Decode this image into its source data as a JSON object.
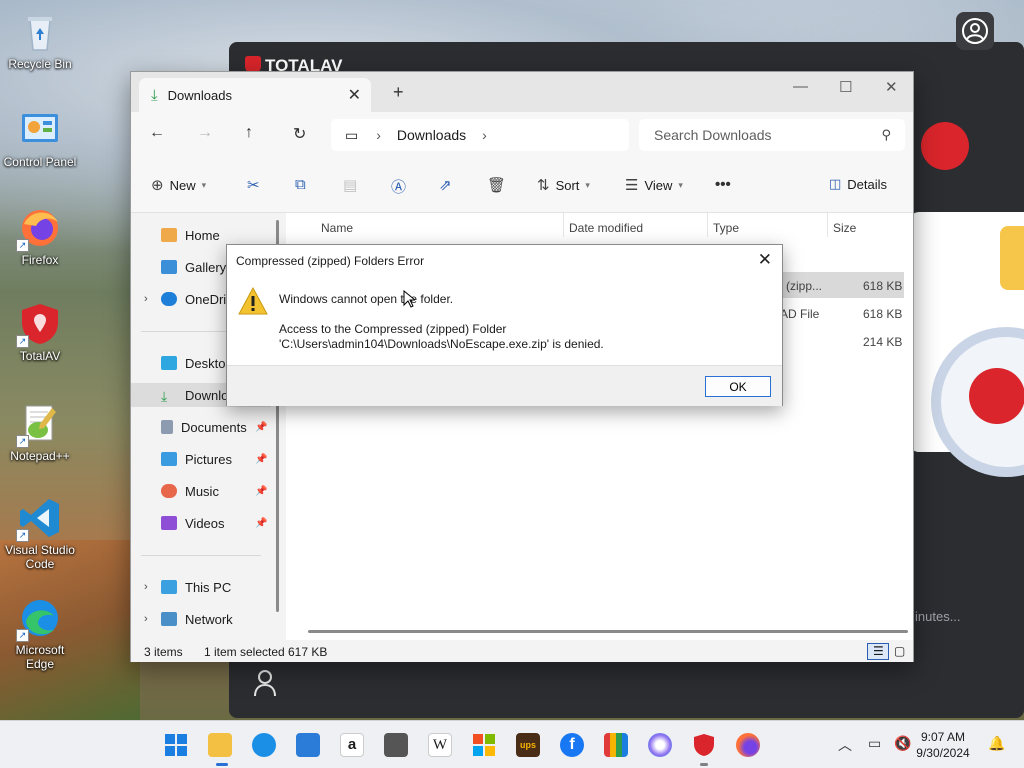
{
  "desktop": {
    "icons": [
      {
        "label": "Recycle Bin"
      },
      {
        "label": "Control Panel"
      },
      {
        "label": "Firefox"
      },
      {
        "label": "TotalAV"
      },
      {
        "label": "Notepad++"
      },
      {
        "label": "Visual Studio Code"
      },
      {
        "label": "Microsoft Edge"
      }
    ]
  },
  "totalav": {
    "brand": "TOTALAV",
    "status_text": "inutes..."
  },
  "explorer": {
    "tab_title": "Downloads",
    "breadcrumb": "Downloads",
    "search_placeholder": "Search Downloads",
    "toolbar": {
      "new_label": "New",
      "sort_label": "Sort",
      "view_label": "View",
      "details_label": "Details"
    },
    "nav": {
      "home": "Home",
      "gallery": "Gallery",
      "onedrive": "OneDriv",
      "desktop": "Desktop",
      "downloads": "Downlo",
      "documents": "Documents",
      "pictures": "Pictures",
      "music": "Music",
      "videos": "Videos",
      "thispc": "This PC",
      "network": "Network"
    },
    "columns": {
      "name": "Name",
      "date": "Date modified",
      "type": "Type",
      "size": "Size"
    },
    "rows": [
      {
        "type": "(zipp...",
        "size": "618 KB"
      },
      {
        "type": "AD File",
        "size": "618 KB"
      },
      {
        "type": "",
        "size": "214 KB"
      }
    ],
    "status": {
      "items": "3 items",
      "selected": "1 item selected",
      "selected_size": "617 KB"
    }
  },
  "dialog": {
    "title": "Compressed (zipped) Folders Error",
    "message": "Windows cannot open the folder.",
    "detail": "Access to the Compressed (zipped) Folder 'C:\\Users\\admin104\\Downloads\\NoEscape.exe.zip' is denied.",
    "ok_label": "OK"
  },
  "taskbar": {
    "time": "9:07 AM",
    "date": "9/30/2024"
  },
  "colors": {
    "accent": "#2a6fd6",
    "warning": "#f2c230",
    "totalav_red": "#d9252b"
  }
}
